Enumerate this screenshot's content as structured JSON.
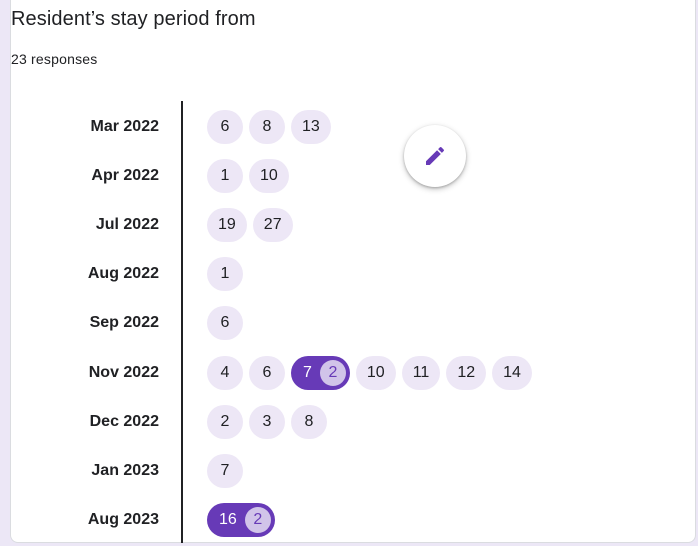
{
  "question": {
    "title": "Resident’s stay period from",
    "responses": "23 responses"
  },
  "rows": [
    {
      "month": "Mar 2022",
      "days": [
        {
          "day": "6"
        },
        {
          "day": "8"
        },
        {
          "day": "13"
        }
      ]
    },
    {
      "month": "Apr 2022",
      "days": [
        {
          "day": "1"
        },
        {
          "day": "10"
        }
      ]
    },
    {
      "month": "Jul 2022",
      "days": [
        {
          "day": "19"
        },
        {
          "day": "27"
        }
      ]
    },
    {
      "month": "Aug 2022",
      "days": [
        {
          "day": "1"
        }
      ]
    },
    {
      "month": "Sep 2022",
      "days": [
        {
          "day": "6"
        }
      ]
    },
    {
      "month": "Nov 2022",
      "days": [
        {
          "day": "4"
        },
        {
          "day": "6"
        },
        {
          "day": "7",
          "count": "2"
        },
        {
          "day": "10"
        },
        {
          "day": "11"
        },
        {
          "day": "12"
        },
        {
          "day": "14"
        }
      ]
    },
    {
      "month": "Dec 2022",
      "days": [
        {
          "day": "2"
        },
        {
          "day": "3"
        },
        {
          "day": "8"
        }
      ]
    },
    {
      "month": "Jan 2023",
      "days": [
        {
          "day": "7"
        }
      ]
    },
    {
      "month": "Aug 2023",
      "days": [
        {
          "day": "16",
          "count": "2"
        }
      ]
    }
  ],
  "fab": {
    "icon": "pencil-icon"
  },
  "colors": {
    "accent": "#673ab7",
    "chip_bg": "#ede7f6",
    "count_bg": "#d1c4e9",
    "page_bg": "#ece7f6"
  }
}
